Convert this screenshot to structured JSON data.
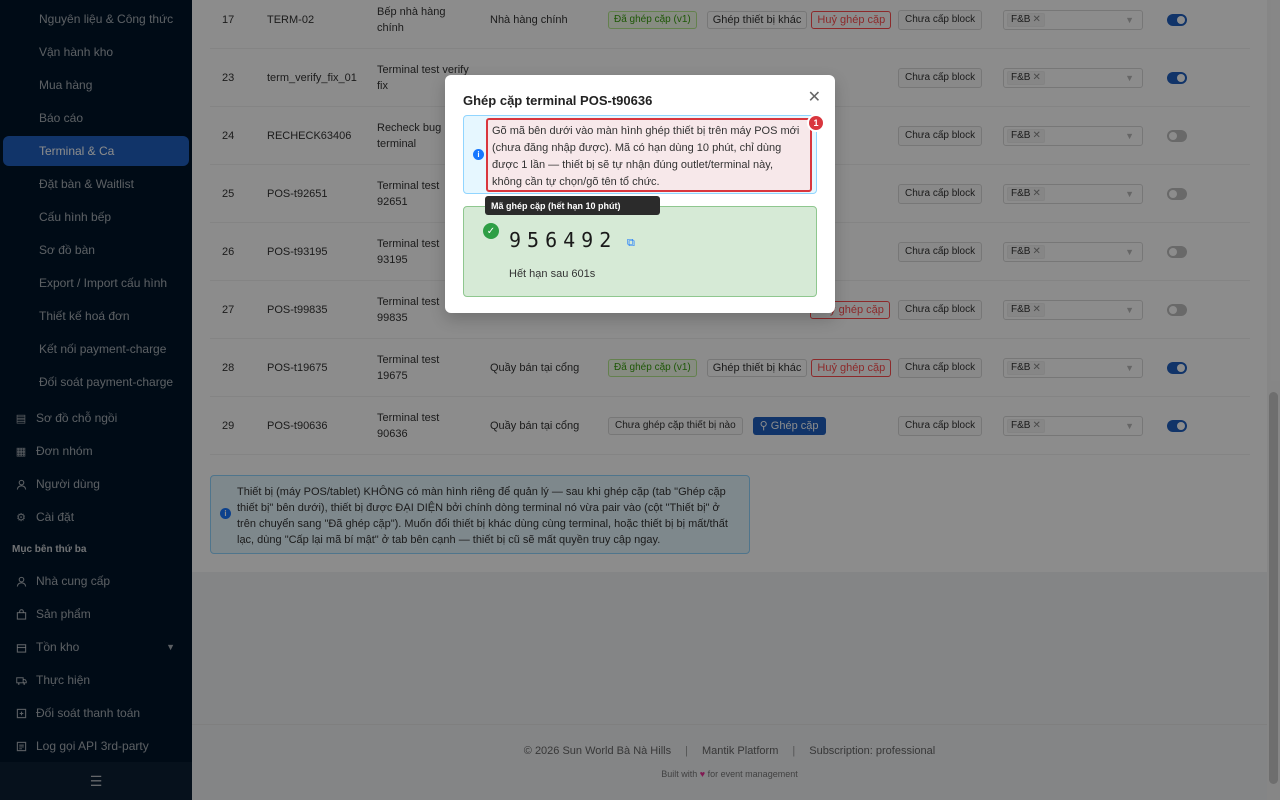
{
  "sidebar": {
    "sub_items": [
      {
        "label": "Nguyên liệu & Công thức"
      },
      {
        "label": "Vận hành kho"
      },
      {
        "label": "Mua hàng"
      },
      {
        "label": "Báo cáo"
      },
      {
        "label": "Terminal & Ca"
      },
      {
        "label": "Đặt bàn & Waitlist"
      },
      {
        "label": "Cấu hình bếp"
      },
      {
        "label": "Sơ đồ bàn"
      },
      {
        "label": "Export / Import cấu hình"
      },
      {
        "label": "Thiết kế hoá đơn"
      },
      {
        "label": "Kết nối payment-charge"
      },
      {
        "label": "Đối soát payment-charge"
      }
    ],
    "top_items": [
      {
        "label": "Sơ đồ chỗ ngồi",
        "icon": "seat-map-icon"
      },
      {
        "label": "Đơn nhóm",
        "icon": "grid-icon"
      },
      {
        "label": "Người dùng",
        "icon": "user-icon"
      },
      {
        "label": "Cài đặt",
        "icon": "gear-icon"
      }
    ],
    "group_title": "Mục bên thứ ba",
    "third_party_items": [
      {
        "label": "Nhà cung cấp",
        "icon": "user-icon"
      },
      {
        "label": "Sản phẩm",
        "icon": "bag-icon"
      },
      {
        "label": "Tồn kho",
        "icon": "box-icon"
      },
      {
        "label": "Thực hiện",
        "icon": "truck-icon"
      },
      {
        "label": "Đối soát thanh toán",
        "icon": "reconcile-icon"
      },
      {
        "label": "Log gọi API 3rd-party",
        "icon": "log-icon"
      }
    ],
    "collapse_icon": "menu-fold-icon"
  },
  "table": {
    "rows": [
      {
        "no": "17",
        "code": "TERM-02",
        "name": "Bếp nhà hàng chính",
        "location": "Nhà hàng chính",
        "status": "Đã ghép cặp (v1)",
        "btn_other": "Ghép thiết bị khác",
        "btn_unpair": "Huỷ ghép cặp",
        "block": "Chưa cấp block",
        "tag": "F&B",
        "enabled": true
      },
      {
        "no": "23",
        "code": "term_verify_fix_01",
        "name": "Terminal test verify fix",
        "location": "",
        "status": "",
        "block": "Chưa cấp block",
        "tag": "F&B",
        "enabled": true
      },
      {
        "no": "24",
        "code": "RECHECK63406",
        "name": "Recheck bug terminal",
        "location": "",
        "status": "",
        "block": "Chưa cấp block",
        "tag": "F&B",
        "enabled": false
      },
      {
        "no": "25",
        "code": "POS-t92651",
        "name": "Terminal test 92651",
        "location": "",
        "status": "",
        "block": "Chưa cấp block",
        "tag": "F&B",
        "enabled": false
      },
      {
        "no": "26",
        "code": "POS-t93195",
        "name": "Terminal test 93195",
        "location": "",
        "status": "",
        "block": "Chưa cấp block",
        "tag": "F&B",
        "enabled": false
      },
      {
        "no": "27",
        "code": "POS-t99835",
        "name": "Terminal test 99835",
        "location": "",
        "status": "",
        "btn_unpair": "Huỷ ghép cặp",
        "block": "Chưa cấp block",
        "tag": "F&B",
        "enabled": false
      },
      {
        "no": "28",
        "code": "POS-t19675",
        "name": "Terminal test 19675",
        "location": "Quầy bán tại cổng",
        "status": "Đã ghép cặp (v1)",
        "btn_other": "Ghép thiết bị khác",
        "btn_unpair": "Huỷ ghép cặp",
        "block": "Chưa cấp block",
        "tag": "F&B",
        "enabled": true
      },
      {
        "no": "29",
        "code": "POS-t90636",
        "name": "Terminal test 90636",
        "location": "Quầy bán tại cổng",
        "status_none": "Chưa ghép cặp thiết bị nào",
        "btn_pair": "Ghép cặp",
        "block": "Chưa cấp block",
        "tag": "F&B",
        "enabled": true
      }
    ]
  },
  "info_note": "Thiết bị (máy POS/tablet) KHÔNG có màn hình riêng để quản lý — sau khi ghép cặp (tab \"Ghép cặp thiết bị\" bên dưới), thiết bị được ĐẠI DIỆN bởi chính dòng terminal nó vừa pair vào (cột \"Thiết bị\" ở trên chuyển sang \"Đã ghép cặp\"). Muốn đổi thiết bị khác dùng cùng terminal, hoặc thiết bị bị mất/thất lạc, dùng \"Cấp lại mã bí mật\" ở tab bên cạnh — thiết bị cũ sẽ mất quyền truy cập ngay.",
  "footer": {
    "copyright": "© 2026 Sun World Bà Nà Hills",
    "platform": "Mantik Platform",
    "subscription": "Subscription: professional",
    "built_with_prefix": "Built with",
    "built_with_suffix": "for event management"
  },
  "modal": {
    "title": "Ghép cặp terminal POS-t90636",
    "info": "Gõ mã bên dưới vào màn hình ghép thiết bị trên máy POS mới (chưa đăng nhập được). Mã có hạn dùng 10 phút, chỉ dùng được 1 lần — thiết bị sẽ tự nhận đúng outlet/terminal này, không cần tự chọn/gõ tên tổ chức.",
    "badge": "1",
    "tooltip": "Mã ghép cặp (hết hạn 10 phút)",
    "code": "956492",
    "expiry": "Hết hạn sau 601s"
  }
}
